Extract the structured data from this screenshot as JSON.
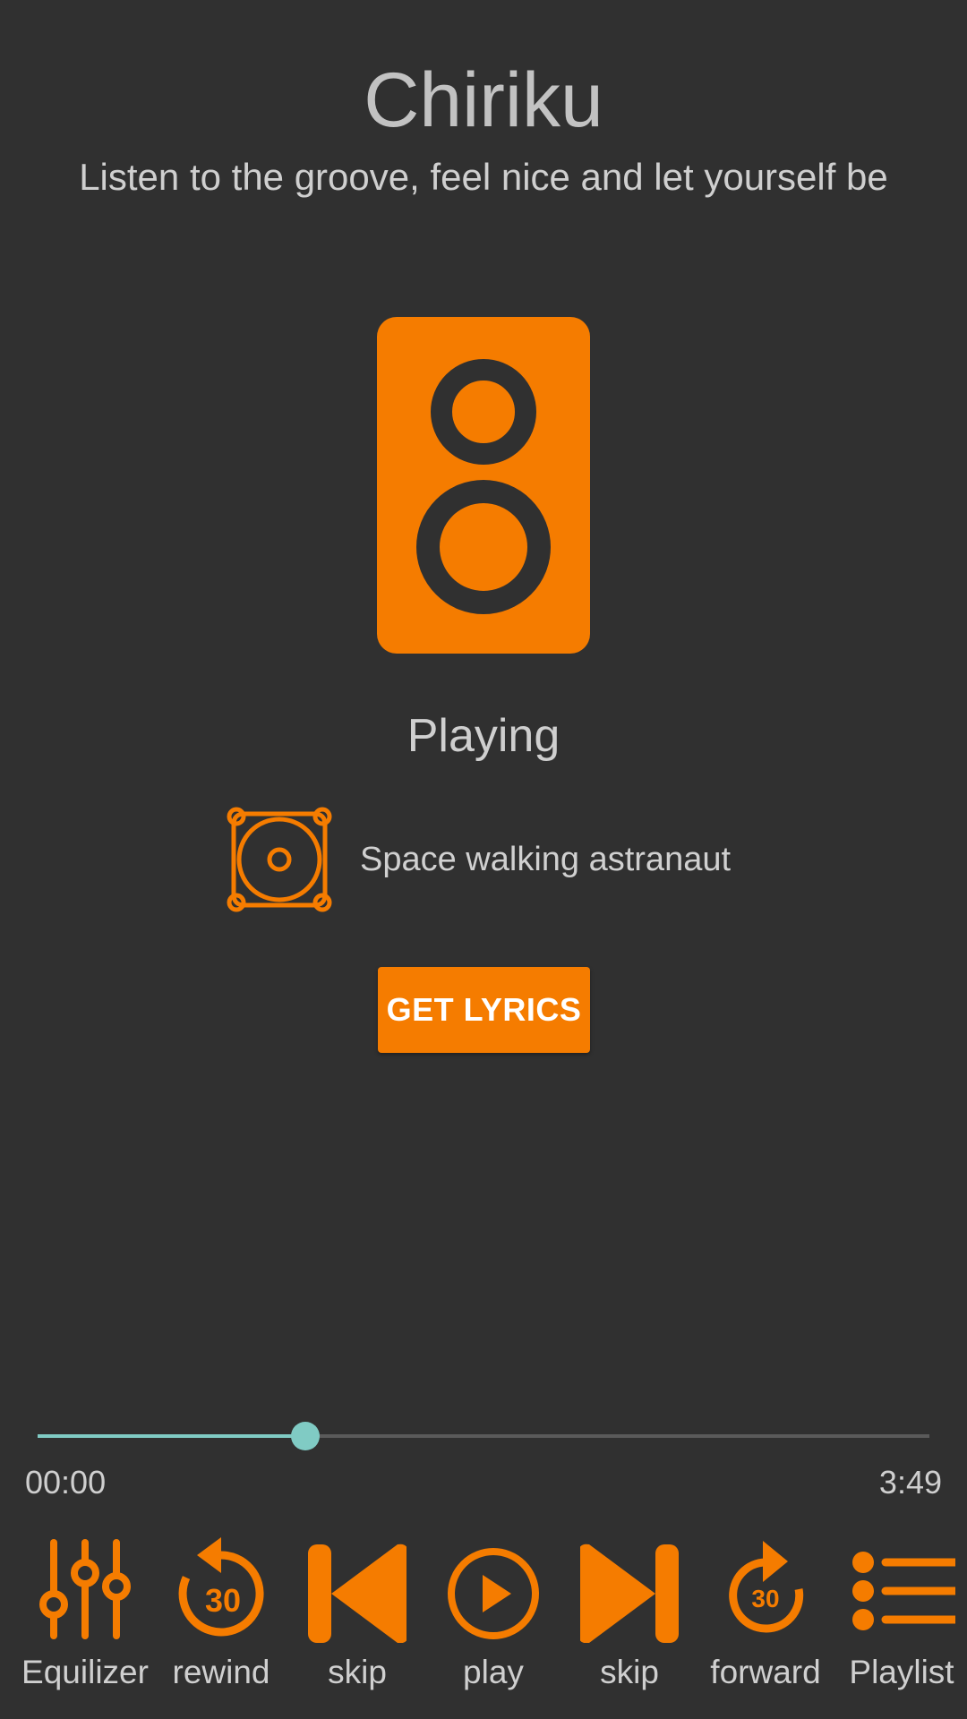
{
  "header": {
    "title": "Chiriku",
    "subtitle": "Listen to the groove, feel nice and let yourself be"
  },
  "hero": {
    "icon": "speaker-icon"
  },
  "player": {
    "status": "Playing",
    "track_icon": "speaker-circle-icon",
    "track_name": "Space walking astranaut",
    "lyrics_button": "GET LYRICS",
    "progress_fraction": 0.3,
    "time_start": "00:00",
    "time_end": "3:49"
  },
  "controls": [
    {
      "label": "Equilizer",
      "icon": "equalizer-icon"
    },
    {
      "label": "rewind",
      "icon": "replay-30-icon"
    },
    {
      "label": "skip",
      "icon": "skip-previous-icon"
    },
    {
      "label": "play",
      "icon": "play-circle-icon"
    },
    {
      "label": "skip",
      "icon": "skip-next-icon"
    },
    {
      "label": "forward",
      "icon": "forward-30-icon"
    },
    {
      "label": "Playlist",
      "icon": "playlist-icon"
    }
  ],
  "colors": {
    "background": "#303030",
    "accent": "#f57c00",
    "progress": "#80cbc4"
  }
}
